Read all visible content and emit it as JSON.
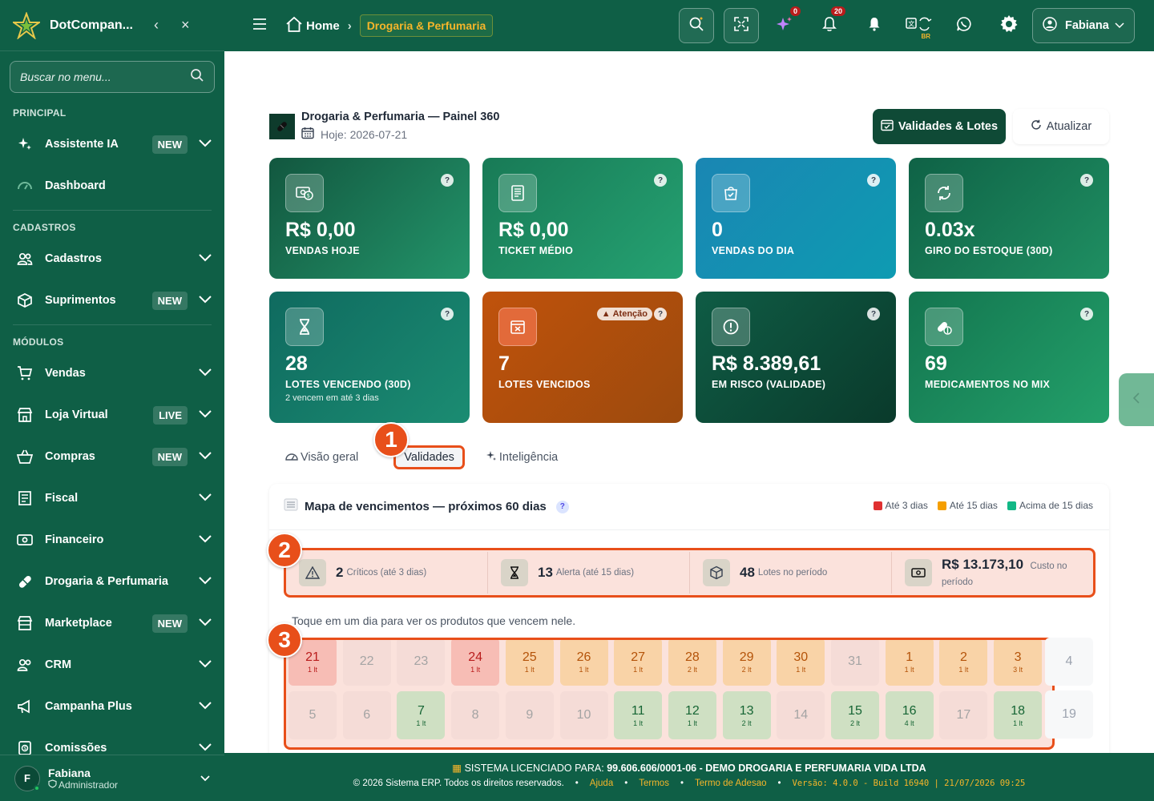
{
  "sidebar": {
    "brand": "DotCompan...",
    "search_placeholder": "Buscar no menu...",
    "sections": {
      "principal": "PRINCIPAL",
      "cadastros": "CADASTROS",
      "modulos": "MÓDULOS"
    },
    "items": [
      {
        "label": "Assistente IA",
        "badge": "NEW",
        "icon": "sparkles-icon"
      },
      {
        "label": "Dashboard",
        "badge": "",
        "icon": "gauge-icon"
      },
      {
        "label": "Cadastros",
        "badge": "",
        "icon": "users-icon"
      },
      {
        "label": "Suprimentos",
        "badge": "NEW",
        "icon": "box-icon"
      },
      {
        "label": "Vendas",
        "badge": "",
        "icon": "cart-icon"
      },
      {
        "label": "Loja Virtual",
        "badge": "LIVE",
        "icon": "store-icon"
      },
      {
        "label": "Compras",
        "badge": "NEW",
        "icon": "basket-icon"
      },
      {
        "label": "Fiscal",
        "badge": "",
        "icon": "receipt-icon"
      },
      {
        "label": "Financeiro",
        "badge": "",
        "icon": "cash-icon"
      },
      {
        "label": "Drogaria & Perfumaria",
        "badge": "",
        "icon": "pill-icon"
      },
      {
        "label": "Marketplace",
        "badge": "NEW",
        "icon": "shop-icon"
      },
      {
        "label": "CRM",
        "badge": "",
        "icon": "people-icon"
      },
      {
        "label": "Campanha Plus",
        "badge": "",
        "icon": "megaphone-icon"
      },
      {
        "label": "Comissões",
        "badge": "",
        "icon": "coins-icon"
      }
    ],
    "user": {
      "initial": "F",
      "name": "Fabiana",
      "role": "Administrador"
    }
  },
  "topbar": {
    "breadcrumb_home": "Home",
    "breadcrumb_current": "Drogaria & Perfumaria",
    "ai_badge": "0",
    "notif_badge": "20",
    "lang_tag": "BR",
    "user_name": "Fabiana"
  },
  "page": {
    "title": "Drogaria & Perfumaria — Painel 360",
    "date": "Hoje: 2026-07-21",
    "btn_validades": "Validades & Lotes",
    "btn_refresh": "Atualizar"
  },
  "kpis": [
    {
      "value": "R$ 0,00",
      "label": "VENDAS HOJE",
      "sub": "",
      "icon": "money-icon",
      "color": "#1e7a55"
    },
    {
      "value": "R$ 0,00",
      "label": "TICKET MÉDIO",
      "sub": "",
      "icon": "receipt-icon",
      "color": "#23946a"
    },
    {
      "value": "0",
      "label": "VENDAS DO DIA",
      "sub": "",
      "icon": "bag-check-icon",
      "color": "#1296b8"
    },
    {
      "value": "0.03x",
      "label": "GIRO DO ESTOQUE (30D)",
      "sub": "",
      "icon": "refresh-icon",
      "color": "#1b7d58"
    },
    {
      "value": "28",
      "label": "LOTES VENCENDO (30D)",
      "sub": "2 vencem em até 3 dias",
      "icon": "hourglass-icon",
      "color": "#147a6e"
    },
    {
      "value": "7",
      "label": "LOTES VENCIDOS",
      "sub": "",
      "warn": "Atenção",
      "icon": "calendar-x-icon",
      "color": "#b8540b"
    },
    {
      "value": "R$ 8.389,61",
      "label": "EM RISCO (VALIDADE)",
      "sub": "",
      "icon": "alert-circle-icon",
      "color": "#0d4f3c"
    },
    {
      "value": "69",
      "label": "MEDICAMENTOS NO MIX",
      "sub": "",
      "icon": "capsule-icon",
      "color": "#1e8c60"
    }
  ],
  "tabs": {
    "overview": "Visão geral",
    "validades": "Validades",
    "intel": "Inteligência"
  },
  "markers": [
    "1",
    "2",
    "3"
  ],
  "map": {
    "title": "Mapa de vencimentos — próximos 60 dias",
    "legend": [
      {
        "label": "Até 3 dias",
        "color": "#e03131"
      },
      {
        "label": "Até 15 dias",
        "color": "#f59f00"
      },
      {
        "label": "Acima de 15 dias",
        "color": "#12b886"
      }
    ],
    "stats": [
      {
        "value": "2",
        "label": "Críticos (até 3 dias)",
        "icon": "warning-icon"
      },
      {
        "value": "13",
        "label": "Alerta (até 15 dias)",
        "icon": "hourglass-icon"
      },
      {
        "value": "48",
        "label": "Lotes no período",
        "icon": "box-icon"
      },
      {
        "value": "R$ 13.173,10",
        "label": "Custo no período",
        "icon": "cash-icon"
      }
    ],
    "hint": "Toque em um dia para ver os produtos que vencem nele.",
    "row1": [
      {
        "d": "21",
        "c": "1 lt",
        "s": "red"
      },
      {
        "d": "22",
        "c": "",
        "s": "empty"
      },
      {
        "d": "23",
        "c": "",
        "s": "empty"
      },
      {
        "d": "24",
        "c": "1 lt",
        "s": "red"
      },
      {
        "d": "25",
        "c": "1 lt",
        "s": "orange"
      },
      {
        "d": "26",
        "c": "1 lt",
        "s": "orange"
      },
      {
        "d": "27",
        "c": "1 lt",
        "s": "orange"
      },
      {
        "d": "28",
        "c": "2 lt",
        "s": "orange"
      },
      {
        "d": "29",
        "c": "2 lt",
        "s": "orange"
      },
      {
        "d": "30",
        "c": "1 lt",
        "s": "orange"
      },
      {
        "d": "31",
        "c": "",
        "s": "empty"
      },
      {
        "d": "1",
        "c": "1 lt",
        "s": "orange"
      },
      {
        "d": "2",
        "c": "1 lt",
        "s": "orange"
      },
      {
        "d": "3",
        "c": "3 lt",
        "s": "orange"
      }
    ],
    "row2": [
      {
        "d": "5",
        "c": "",
        "s": "empty"
      },
      {
        "d": "6",
        "c": "",
        "s": "empty"
      },
      {
        "d": "7",
        "c": "1 lt",
        "s": "green"
      },
      {
        "d": "8",
        "c": "",
        "s": "empty"
      },
      {
        "d": "9",
        "c": "",
        "s": "empty"
      },
      {
        "d": "10",
        "c": "",
        "s": "empty"
      },
      {
        "d": "11",
        "c": "1 lt",
        "s": "green"
      },
      {
        "d": "12",
        "c": "1 lt",
        "s": "green"
      },
      {
        "d": "13",
        "c": "2 lt",
        "s": "green"
      },
      {
        "d": "14",
        "c": "",
        "s": "empty"
      },
      {
        "d": "15",
        "c": "2 lt",
        "s": "green"
      },
      {
        "d": "16",
        "c": "4 lt",
        "s": "green"
      },
      {
        "d": "17",
        "c": "",
        "s": "empty"
      },
      {
        "d": "18",
        "c": "1 lt",
        "s": "green"
      }
    ],
    "outside": [
      "4",
      "19"
    ]
  },
  "footer": {
    "license_prefix": "SISTEMA LICENCIADO PARA:",
    "license_holder": "99.606.606/0001-06 - DEMO DROGARIA E PERFUMARIA VIDA LTDA",
    "copyright": "© 2026 Sistema ERP. Todos os direitos reservados.",
    "link_help": "Ajuda",
    "link_terms": "Termos",
    "link_adesao": "Termo de Adesao",
    "version": "Versão: 4.0.0 - Build 16940 | 21/07/2026 09:25"
  }
}
